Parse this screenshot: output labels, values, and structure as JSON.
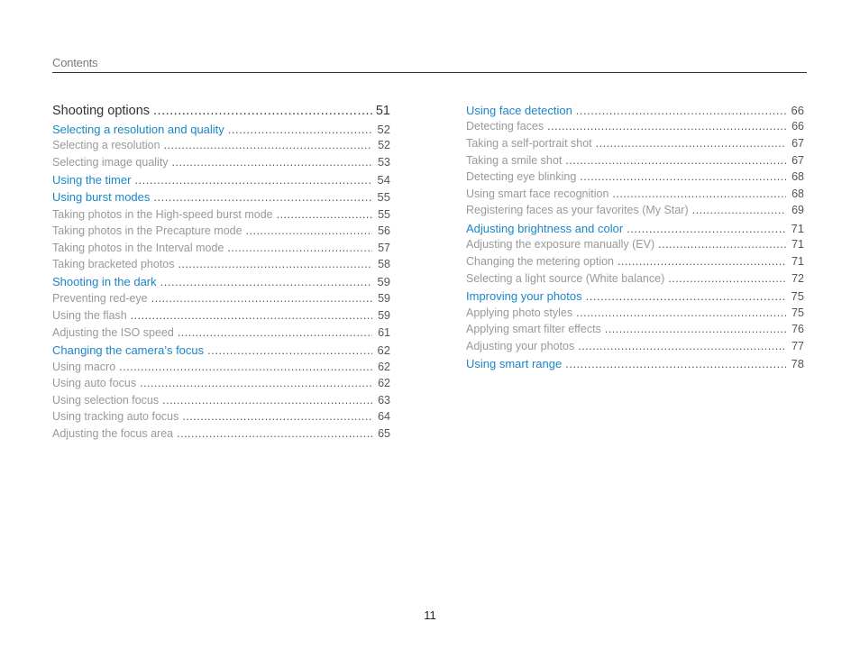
{
  "header": {
    "title": "Contents"
  },
  "left_column": [
    {
      "level": 0,
      "title": "Shooting options",
      "page": "51"
    },
    {
      "level": 1,
      "title": "Selecting a resolution and quality",
      "page": "52"
    },
    {
      "level": 2,
      "title": "Selecting a resolution",
      "page": "52"
    },
    {
      "level": 2,
      "title": "Selecting image quality",
      "page": "53"
    },
    {
      "level": 1,
      "title": "Using the timer",
      "page": "54"
    },
    {
      "level": 1,
      "title": "Using burst modes",
      "page": "55"
    },
    {
      "level": 2,
      "title": "Taking photos in the High-speed burst mode",
      "page": "55"
    },
    {
      "level": 2,
      "title": "Taking photos in the Precapture mode",
      "page": "56"
    },
    {
      "level": 2,
      "title": "Taking photos in the Interval mode",
      "page": "57"
    },
    {
      "level": 2,
      "title": "Taking bracketed photos",
      "page": "58"
    },
    {
      "level": 1,
      "title": "Shooting in the dark",
      "page": "59"
    },
    {
      "level": 2,
      "title": "Preventing red-eye",
      "page": "59"
    },
    {
      "level": 2,
      "title": "Using the flash",
      "page": "59"
    },
    {
      "level": 2,
      "title": "Adjusting the ISO speed",
      "page": "61"
    },
    {
      "level": 1,
      "title": "Changing the camera’s focus",
      "page": "62"
    },
    {
      "level": 2,
      "title": "Using macro",
      "page": "62"
    },
    {
      "level": 2,
      "title": "Using auto focus",
      "page": "62"
    },
    {
      "level": 2,
      "title": "Using selection focus",
      "page": "63"
    },
    {
      "level": 2,
      "title": "Using tracking auto focus",
      "page": "64"
    },
    {
      "level": 2,
      "title": "Adjusting the focus area",
      "page": "65"
    }
  ],
  "right_column": [
    {
      "level": 1,
      "title": "Using face detection",
      "page": "66"
    },
    {
      "level": 2,
      "title": "Detecting faces",
      "page": "66"
    },
    {
      "level": 2,
      "title": "Taking a self-portrait shot",
      "page": "67"
    },
    {
      "level": 2,
      "title": "Taking a smile shot",
      "page": "67"
    },
    {
      "level": 2,
      "title": "Detecting eye blinking",
      "page": "68"
    },
    {
      "level": 2,
      "title": "Using smart face recognition",
      "page": "68"
    },
    {
      "level": 2,
      "title": "Registering faces as your favorites (My Star)",
      "page": "69"
    },
    {
      "level": 1,
      "title": "Adjusting brightness and color",
      "page": "71"
    },
    {
      "level": 2,
      "title": "Adjusting the exposure manually (EV)",
      "page": "71"
    },
    {
      "level": 2,
      "title": "Changing the metering option",
      "page": "71"
    },
    {
      "level": 2,
      "title": "Selecting a light source (White balance)",
      "page": "72"
    },
    {
      "level": 1,
      "title": "Improving your photos",
      "page": "75"
    },
    {
      "level": 2,
      "title": "Applying photo styles",
      "page": "75"
    },
    {
      "level": 2,
      "title": "Applying smart filter effects",
      "page": "76"
    },
    {
      "level": 2,
      "title": "Adjusting your photos",
      "page": "77"
    },
    {
      "level": 1,
      "title": "Using smart range",
      "page": "78"
    }
  ],
  "footer": {
    "page_number": "11"
  }
}
